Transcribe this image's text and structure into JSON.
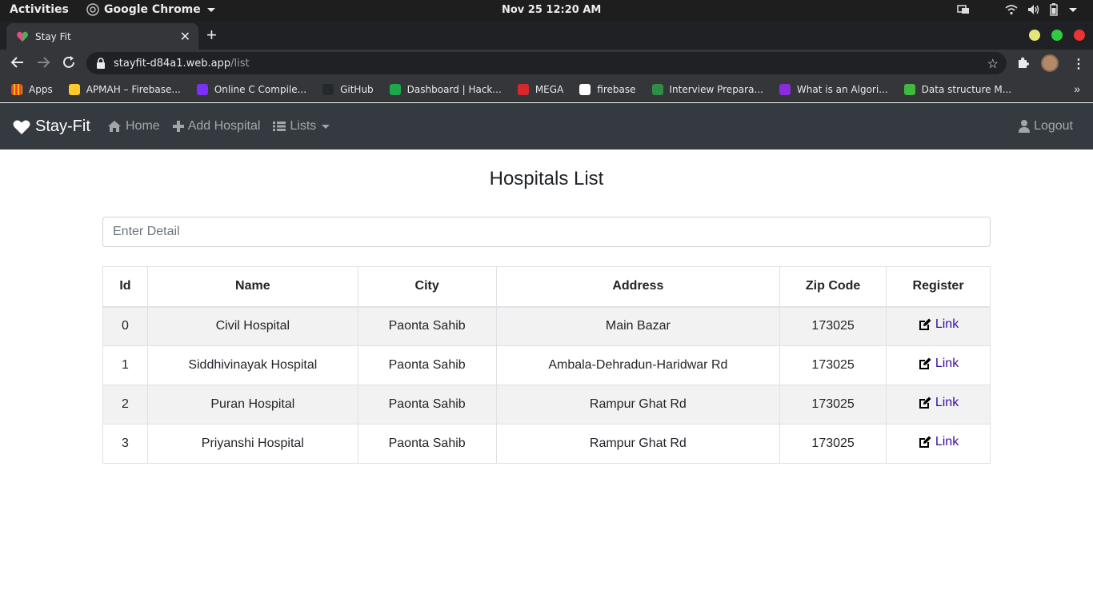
{
  "os": {
    "activities": "Activities",
    "app_name": "Google Chrome",
    "clock": "Nov 25  12:20 AM"
  },
  "browser": {
    "tab_title": "Stay Fit",
    "url_host": "stayfit-d84a1.web.app",
    "url_path": "/list",
    "bookmarks": [
      {
        "label": "Apps",
        "color": "#4285f4"
      },
      {
        "label": "APMAH – Firebase...",
        "color": "#ffca28"
      },
      {
        "label": "Online C Compile...",
        "color": "#7b2ff7"
      },
      {
        "label": "GitHub",
        "color": "#24292e"
      },
      {
        "label": "Dashboard | Hack...",
        "color": "#1ba94c"
      },
      {
        "label": "MEGA",
        "color": "#d9272e"
      },
      {
        "label": "firebase",
        "color": "#ffffff"
      },
      {
        "label": "Interview Prepara...",
        "color": "#2f8d46"
      },
      {
        "label": "What is an Algori...",
        "color": "#8a2be2"
      },
      {
        "label": "Data structure M...",
        "color": "#3fb93f"
      }
    ]
  },
  "navbar": {
    "brand": "Stay-Fit",
    "home": "Home",
    "add_hospital": "Add Hospital",
    "lists": "Lists",
    "logout": "Logout"
  },
  "main": {
    "title": "Hospitals List",
    "search_placeholder": "Enter Detail",
    "columns": [
      "Id",
      "Name",
      "City",
      "Address",
      "Zip Code",
      "Register"
    ],
    "rows": [
      {
        "id": "0",
        "name": "Civil Hospital",
        "city": "Paonta Sahib",
        "address": "Main Bazar",
        "zip": "173025",
        "register": "Link"
      },
      {
        "id": "1",
        "name": "Siddhivinayak Hospital",
        "city": "Paonta Sahib",
        "address": "Ambala-Dehradun-Haridwar Rd",
        "zip": "173025",
        "register": "Link"
      },
      {
        "id": "2",
        "name": "Puran Hospital",
        "city": "Paonta Sahib",
        "address": "Rampur Ghat Rd",
        "zip": "173025",
        "register": "Link"
      },
      {
        "id": "3",
        "name": "Priyanshi Hospital",
        "city": "Paonta Sahib",
        "address": "Rampur Ghat Rd",
        "zip": "173025",
        "register": "Link"
      }
    ]
  }
}
